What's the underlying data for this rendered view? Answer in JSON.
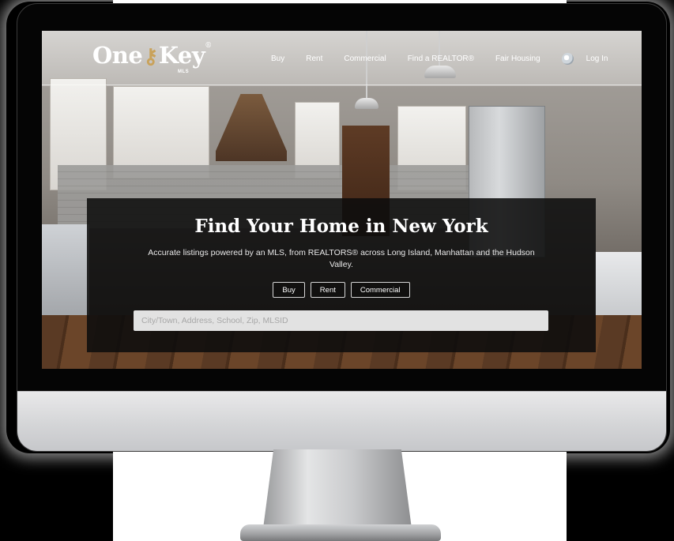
{
  "brand": {
    "logo_left": "One",
    "logo_right": "Key",
    "logo_reg": "®",
    "logo_sub": "MLS"
  },
  "nav": {
    "items": [
      {
        "label": "Buy"
      },
      {
        "label": "Rent"
      },
      {
        "label": "Commercial"
      },
      {
        "label": "Find a REALTOR®"
      },
      {
        "label": "Fair Housing"
      }
    ],
    "login_label": "Log In",
    "globe_icon": "globe-icon"
  },
  "hero": {
    "title": "Find Your Home in New York",
    "subtitle": "Accurate listings powered by an MLS, from REALTORS® across Long Island, Manhattan and the Hudson Valley.",
    "buttons": [
      {
        "label": "Buy"
      },
      {
        "label": "Rent"
      },
      {
        "label": "Commercial"
      }
    ],
    "search": {
      "placeholder": "City/Town, Address, School, Zip, MLSID",
      "value": ""
    }
  },
  "colors": {
    "accent_gold": "#c9a25a",
    "panel": "#0c0c0c",
    "text": "#ffffff"
  }
}
